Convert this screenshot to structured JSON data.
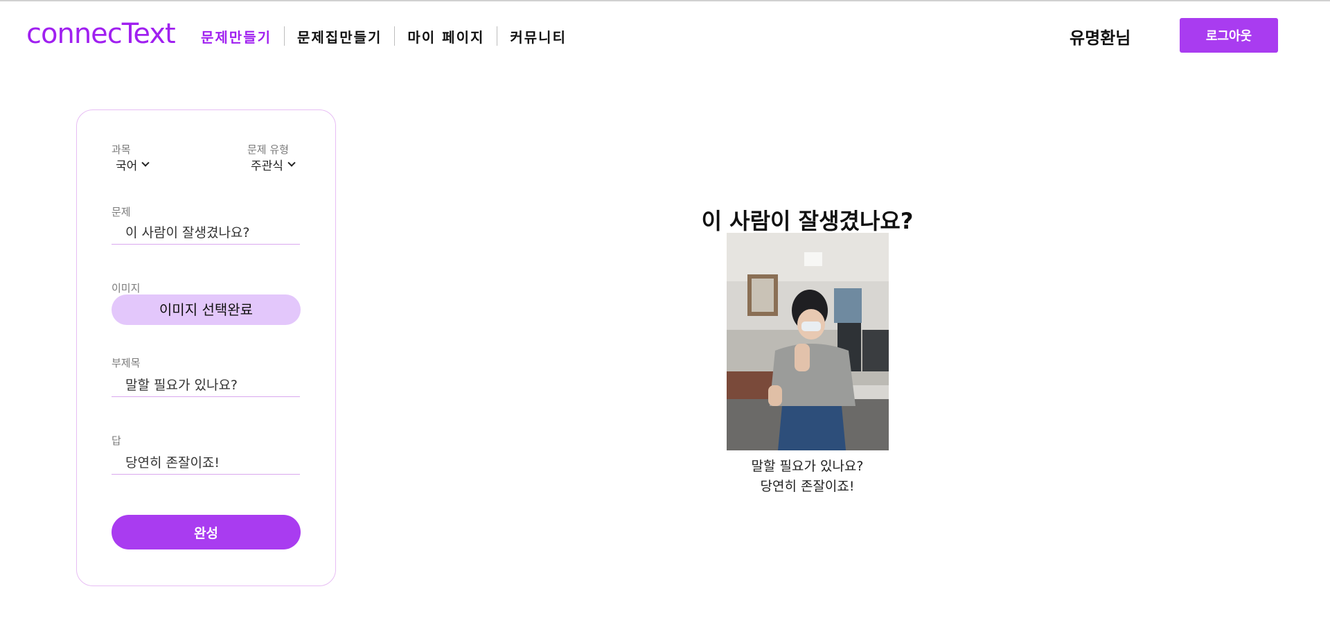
{
  "header": {
    "logo": "connecText",
    "nav": [
      "문제만들기",
      "문제집만들기",
      "마이 페이지",
      "커뮤니티"
    ],
    "active_nav": "문제만들기",
    "username": "유명환님",
    "logout_label": "로그아웃"
  },
  "form": {
    "subject_label": "과목",
    "subject_value": "국어",
    "type_label": "문제 유형",
    "type_value": "주관식",
    "question_label": "문제",
    "question_value": "이 사람이 잘생겼나요?",
    "image_label": "이미지",
    "image_button": "이미지 선택완료",
    "subtitle_label": "부제목",
    "subtitle_value": "말할 필요가 있나요?",
    "answer_label": "답",
    "answer_value": "당연히 존잘이죠!",
    "submit_label": "완성"
  },
  "preview": {
    "title": "이 사람이 잘생겼나요?",
    "subtitle": "말할 필요가 있나요?",
    "answer": "당연히 존잘이죠!"
  },
  "colors": {
    "accent": "#a93cf0",
    "logo": "#a020f0",
    "image_button_bg": "#e3c7fb",
    "card_border": "#e7bdf4"
  }
}
